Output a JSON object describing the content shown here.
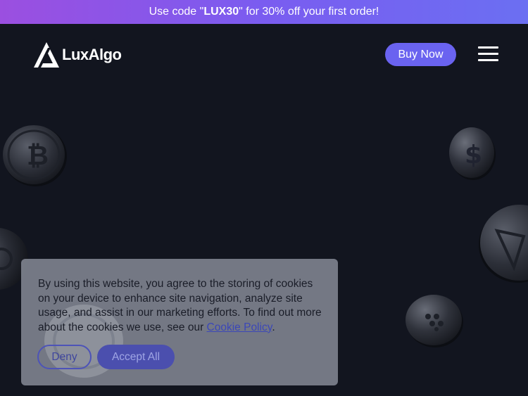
{
  "promo": {
    "prefix": "Use code \"",
    "code": "LUX30",
    "suffix": "\" for 30% off your first order!"
  },
  "header": {
    "logo_text": "LuxAlgo",
    "buy_label": "Buy Now"
  },
  "cookie": {
    "text": "By using this website, you agree to the storing of cookies on your device to enhance site navigation, analyze site usage, and assist in our marketing efforts. To find out more about the cookies we use, see our ",
    "link_label": "Cookie Policy",
    "end": ".",
    "deny_label": "Deny",
    "accept_label": "Accept All"
  },
  "colors": {
    "background": "#12151f",
    "accent": "#6a63f0",
    "promo_gradient_start": "#9b4fe0",
    "promo_gradient_end": "#6b6ff2"
  },
  "icons": [
    "luxalgo-logo-icon",
    "hamburger-menu-icon",
    "bitcoin-coin-icon",
    "dollar-coin-icon",
    "tron-coin-icon",
    "cardano-coin-icon",
    "generic-coin-icon"
  ]
}
